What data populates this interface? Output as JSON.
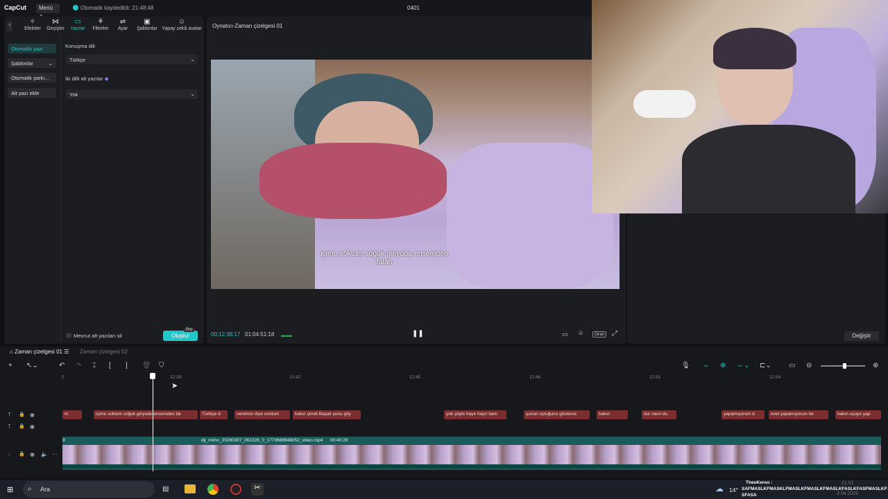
{
  "app": {
    "logo": "CapCut",
    "menu_label": "Menü",
    "autosave": "Otomatik kaydedildi: 21:48:48",
    "project": "0401"
  },
  "toolbar": {
    "items": [
      {
        "label": "Efektler",
        "icon": "sparkle-icon"
      },
      {
        "label": "Geçişler",
        "icon": "transition-icon"
      },
      {
        "label": "Yazılar",
        "icon": "text-icon"
      },
      {
        "label": "Filtreler",
        "icon": "filter-icon"
      },
      {
        "label": "Ayar",
        "icon": "adjust-icon"
      },
      {
        "label": "Şablonlar",
        "icon": "template-icon"
      },
      {
        "label": "Yapay zekâ avatar",
        "icon": "avatar-icon"
      }
    ]
  },
  "sidebar": {
    "items": [
      "Otomatik yazı",
      "Şablonlar",
      "Otomatik şarkı...",
      "Alt yazı ekle"
    ]
  },
  "caption_settings": {
    "language_label": "Konuşma dili",
    "language_value": "Türkçe",
    "bilingual_label": "İki dilli alt yazılar",
    "bilingual_value": "Yok",
    "delete_existing": "Mevcut alt yazıları sil",
    "create_label": "Oluştur",
    "pro_badge": "Pro"
  },
  "player": {
    "title": "Oynatıcı-Zaman çizelgesi 01",
    "subtitle_line1": "içime soktum soğuk giriyodu ensemden",
    "subtitle_line2": "falan",
    "time_current": "00:12:38:17",
    "time_total": "01:04:51:18",
    "ratio_label": "Oran"
  },
  "right_panel": {
    "change_label": "Değiştir"
  },
  "timeline": {
    "tab1": "Zaman çizelgesi 01",
    "tab2": "Zaman çizelgesi 02",
    "ruler": [
      "0",
      "12:39",
      "12:42",
      "12:45",
      "12:48",
      "12:51",
      "12:54"
    ],
    "captions": [
      "m",
      "içime soktum soğuk giriyodu ensemden fal",
      "Türkiye d",
      "nerelisin diye sordum",
      "bakın şimdi Başak şunu göy",
      "yok şöyle hayır hayır banı",
      "şunun uçtuğunu gösterce",
      "bakın",
      "dur nasıl du",
      "yapamıyorum d",
      "evet yapamıyosun he",
      "bakın uçuyo yap"
    ],
    "video_label": "dji_mimo_20260307_062228_0_1773688948052_video.mp4",
    "video_duration": "00:40:29",
    "video_prefix": "9"
  },
  "taskbar": {
    "search": "Ara",
    "temp": "14°",
    "chat_user": "TheoKeroo :",
    "chat_msg": "SAFMASLKFMASKLFMASLKFMASLKFMASLKFASLKFASFMASLKFMASLKFMLAK",
    "chat_msg2": "SFASA",
    "clock_time": "21:51",
    "clock_date": "3.04.2026"
  }
}
